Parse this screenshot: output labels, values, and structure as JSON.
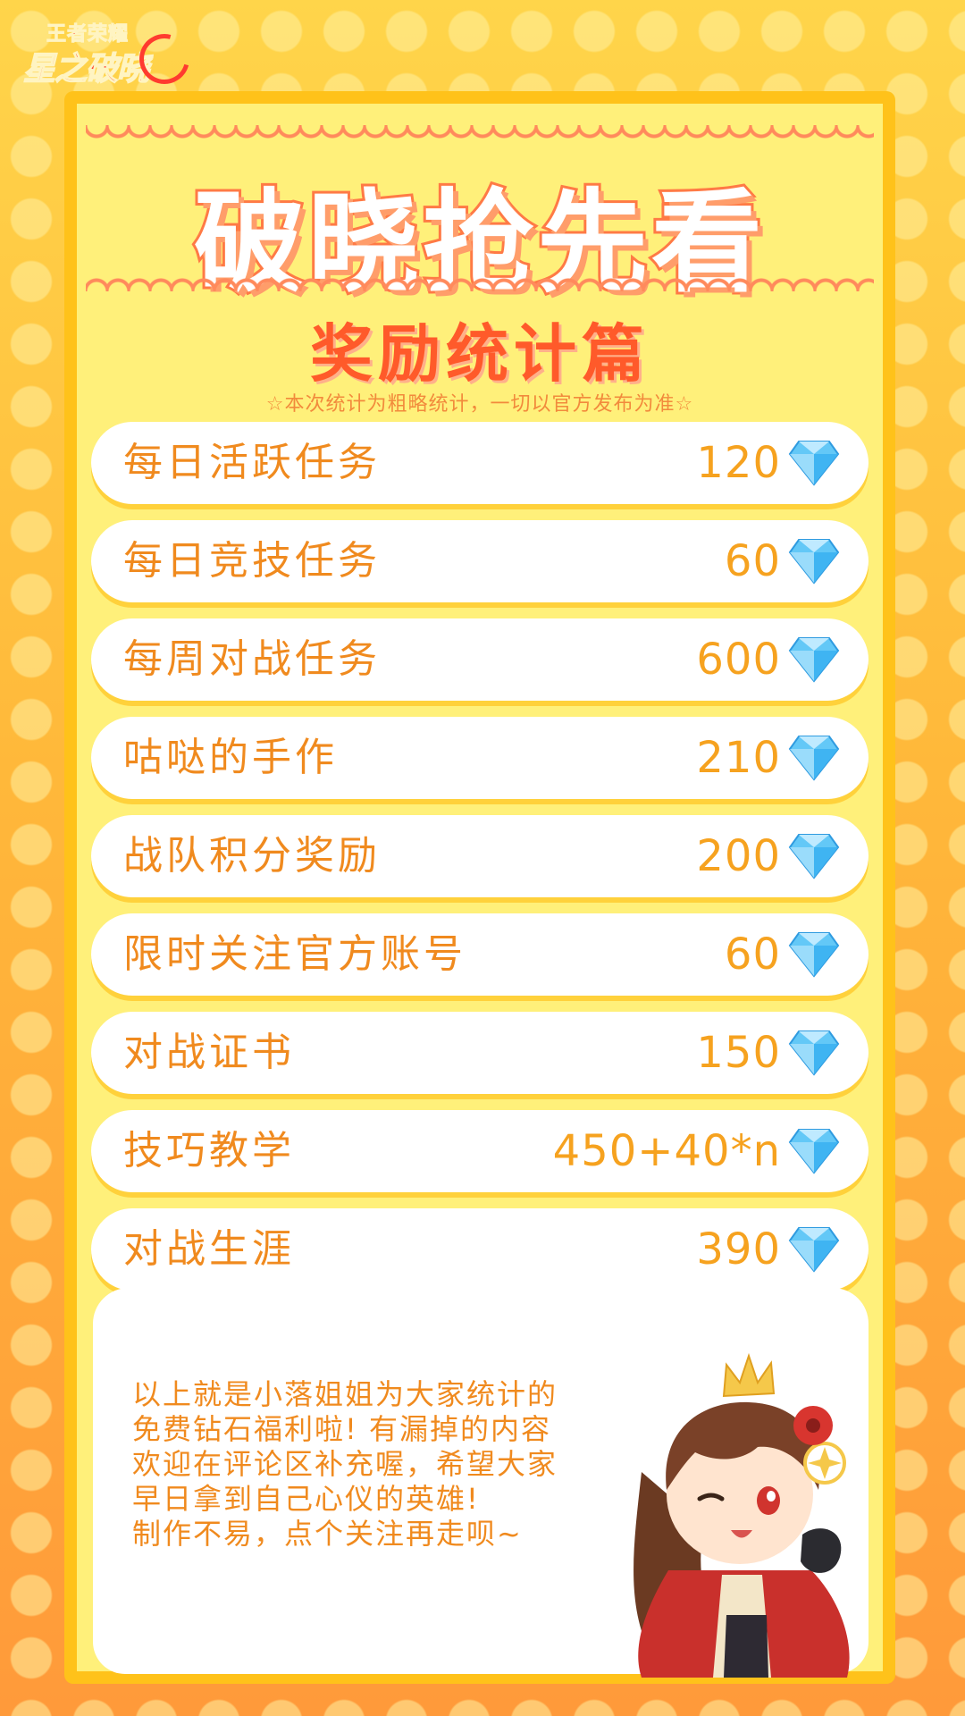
{
  "logo": {
    "line1": "王者荣耀",
    "line2": "星之破晓"
  },
  "header": {
    "title": "破晓抢先看",
    "subtitle": "奖励统计篇",
    "note": "☆本次统计为粗略统计，一切以官方发布为准☆"
  },
  "rewards": [
    {
      "label": "每日活跃任务",
      "value": "120"
    },
    {
      "label": "每日竞技任务",
      "value": "60"
    },
    {
      "label": "每周对战任务",
      "value": "600"
    },
    {
      "label": "咕哒的手作",
      "value": "210"
    },
    {
      "label": "战队积分奖励",
      "value": "200"
    },
    {
      "label": "限时关注官方账号",
      "value": "60"
    },
    {
      "label": "对战证书",
      "value": "150"
    },
    {
      "label": "技巧教学",
      "value": "450+40*n"
    },
    {
      "label": "对战生涯",
      "value": "390"
    }
  ],
  "footer": {
    "lines": [
      "以上就是小落姐姐为大家统计的",
      "免费钻石福利啦! 有漏掉的内容",
      "欢迎在评论区补充喔，希望大家",
      "早日拿到自己心仪的英雄!",
      "制作不易，点个关注再走呗~"
    ]
  },
  "icons": {
    "currency": "diamond-icon",
    "mascot": "character-mascot"
  },
  "colors": {
    "background": "#ffc53a",
    "panel": "#fff07a",
    "panel_border": "#ffc21a",
    "label_text": "#f08a1e",
    "title_accent": "#ff5a2a",
    "gem": "#3fb4f2"
  }
}
